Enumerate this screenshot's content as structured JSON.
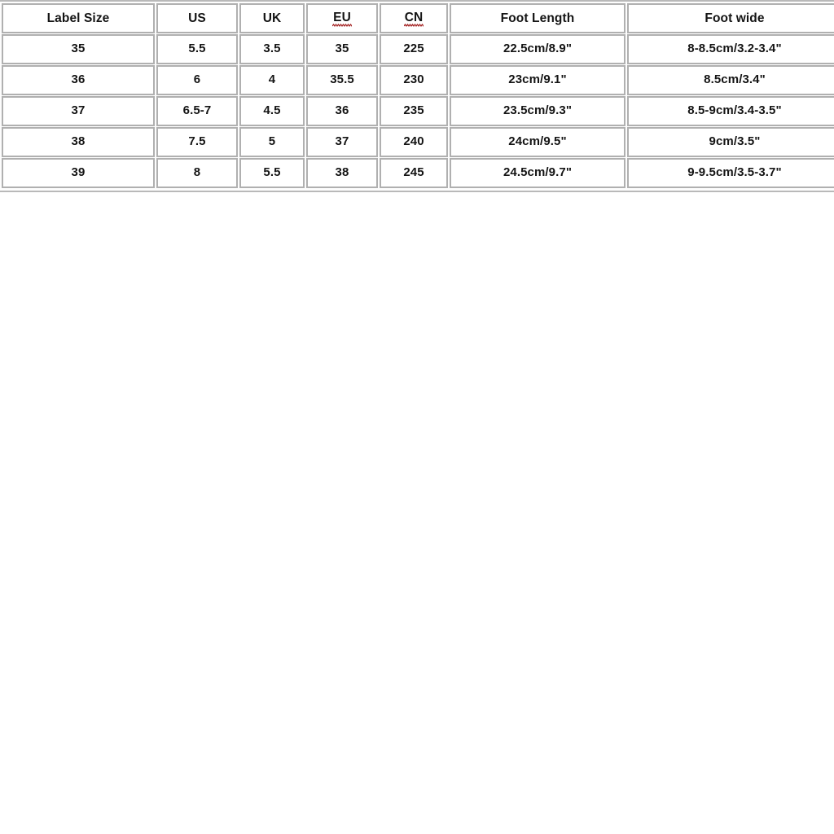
{
  "page": {
    "background_color": "#ffffff",
    "table_border_color": "#b0b0b0",
    "text_color": "#141414",
    "spellcheck_underline_color": "#a32020"
  },
  "table": {
    "name": "shoe-size-conversion-table",
    "columns": [
      {
        "key": "label_size",
        "label": "Label Size",
        "spellcheck": false
      },
      {
        "key": "us",
        "label": "US",
        "spellcheck": false
      },
      {
        "key": "uk",
        "label": "UK",
        "spellcheck": false
      },
      {
        "key": "eu",
        "label": "EU",
        "spellcheck": true
      },
      {
        "key": "cn",
        "label": "CN",
        "spellcheck": true
      },
      {
        "key": "foot_length",
        "label": "Foot Length",
        "spellcheck": false
      },
      {
        "key": "foot_wide",
        "label": "Foot wide",
        "spellcheck": false
      }
    ],
    "headers": {
      "label_size": "Label Size",
      "us": "US",
      "uk": "UK",
      "eu": "EU",
      "cn": "CN",
      "foot_length": "Foot Length",
      "foot_wide": "Foot wide"
    },
    "rows": [
      {
        "label_size": "35",
        "us": "5.5",
        "uk": "3.5",
        "eu": "35",
        "cn": "225",
        "foot_length": "22.5cm/8.9\"",
        "foot_wide": "8-8.5cm/3.2-3.4\""
      },
      {
        "label_size": "36",
        "us": "6",
        "uk": "4",
        "eu": "35.5",
        "cn": "230",
        "foot_length": "23cm/9.1\"",
        "foot_wide": "8.5cm/3.4\""
      },
      {
        "label_size": "37",
        "us": "6.5-7",
        "uk": "4.5",
        "eu": "36",
        "cn": "235",
        "foot_length": "23.5cm/9.3\"",
        "foot_wide": "8.5-9cm/3.4-3.5\""
      },
      {
        "label_size": "38",
        "us": "7.5",
        "uk": "5",
        "eu": "37",
        "cn": "240",
        "foot_length": "24cm/9.5\"",
        "foot_wide": "9cm/3.5\""
      },
      {
        "label_size": "39",
        "us": "8",
        "uk": "5.5",
        "eu": "38",
        "cn": "245",
        "foot_length": "24.5cm/9.7\"",
        "foot_wide": "9-9.5cm/3.5-3.7\""
      }
    ]
  }
}
